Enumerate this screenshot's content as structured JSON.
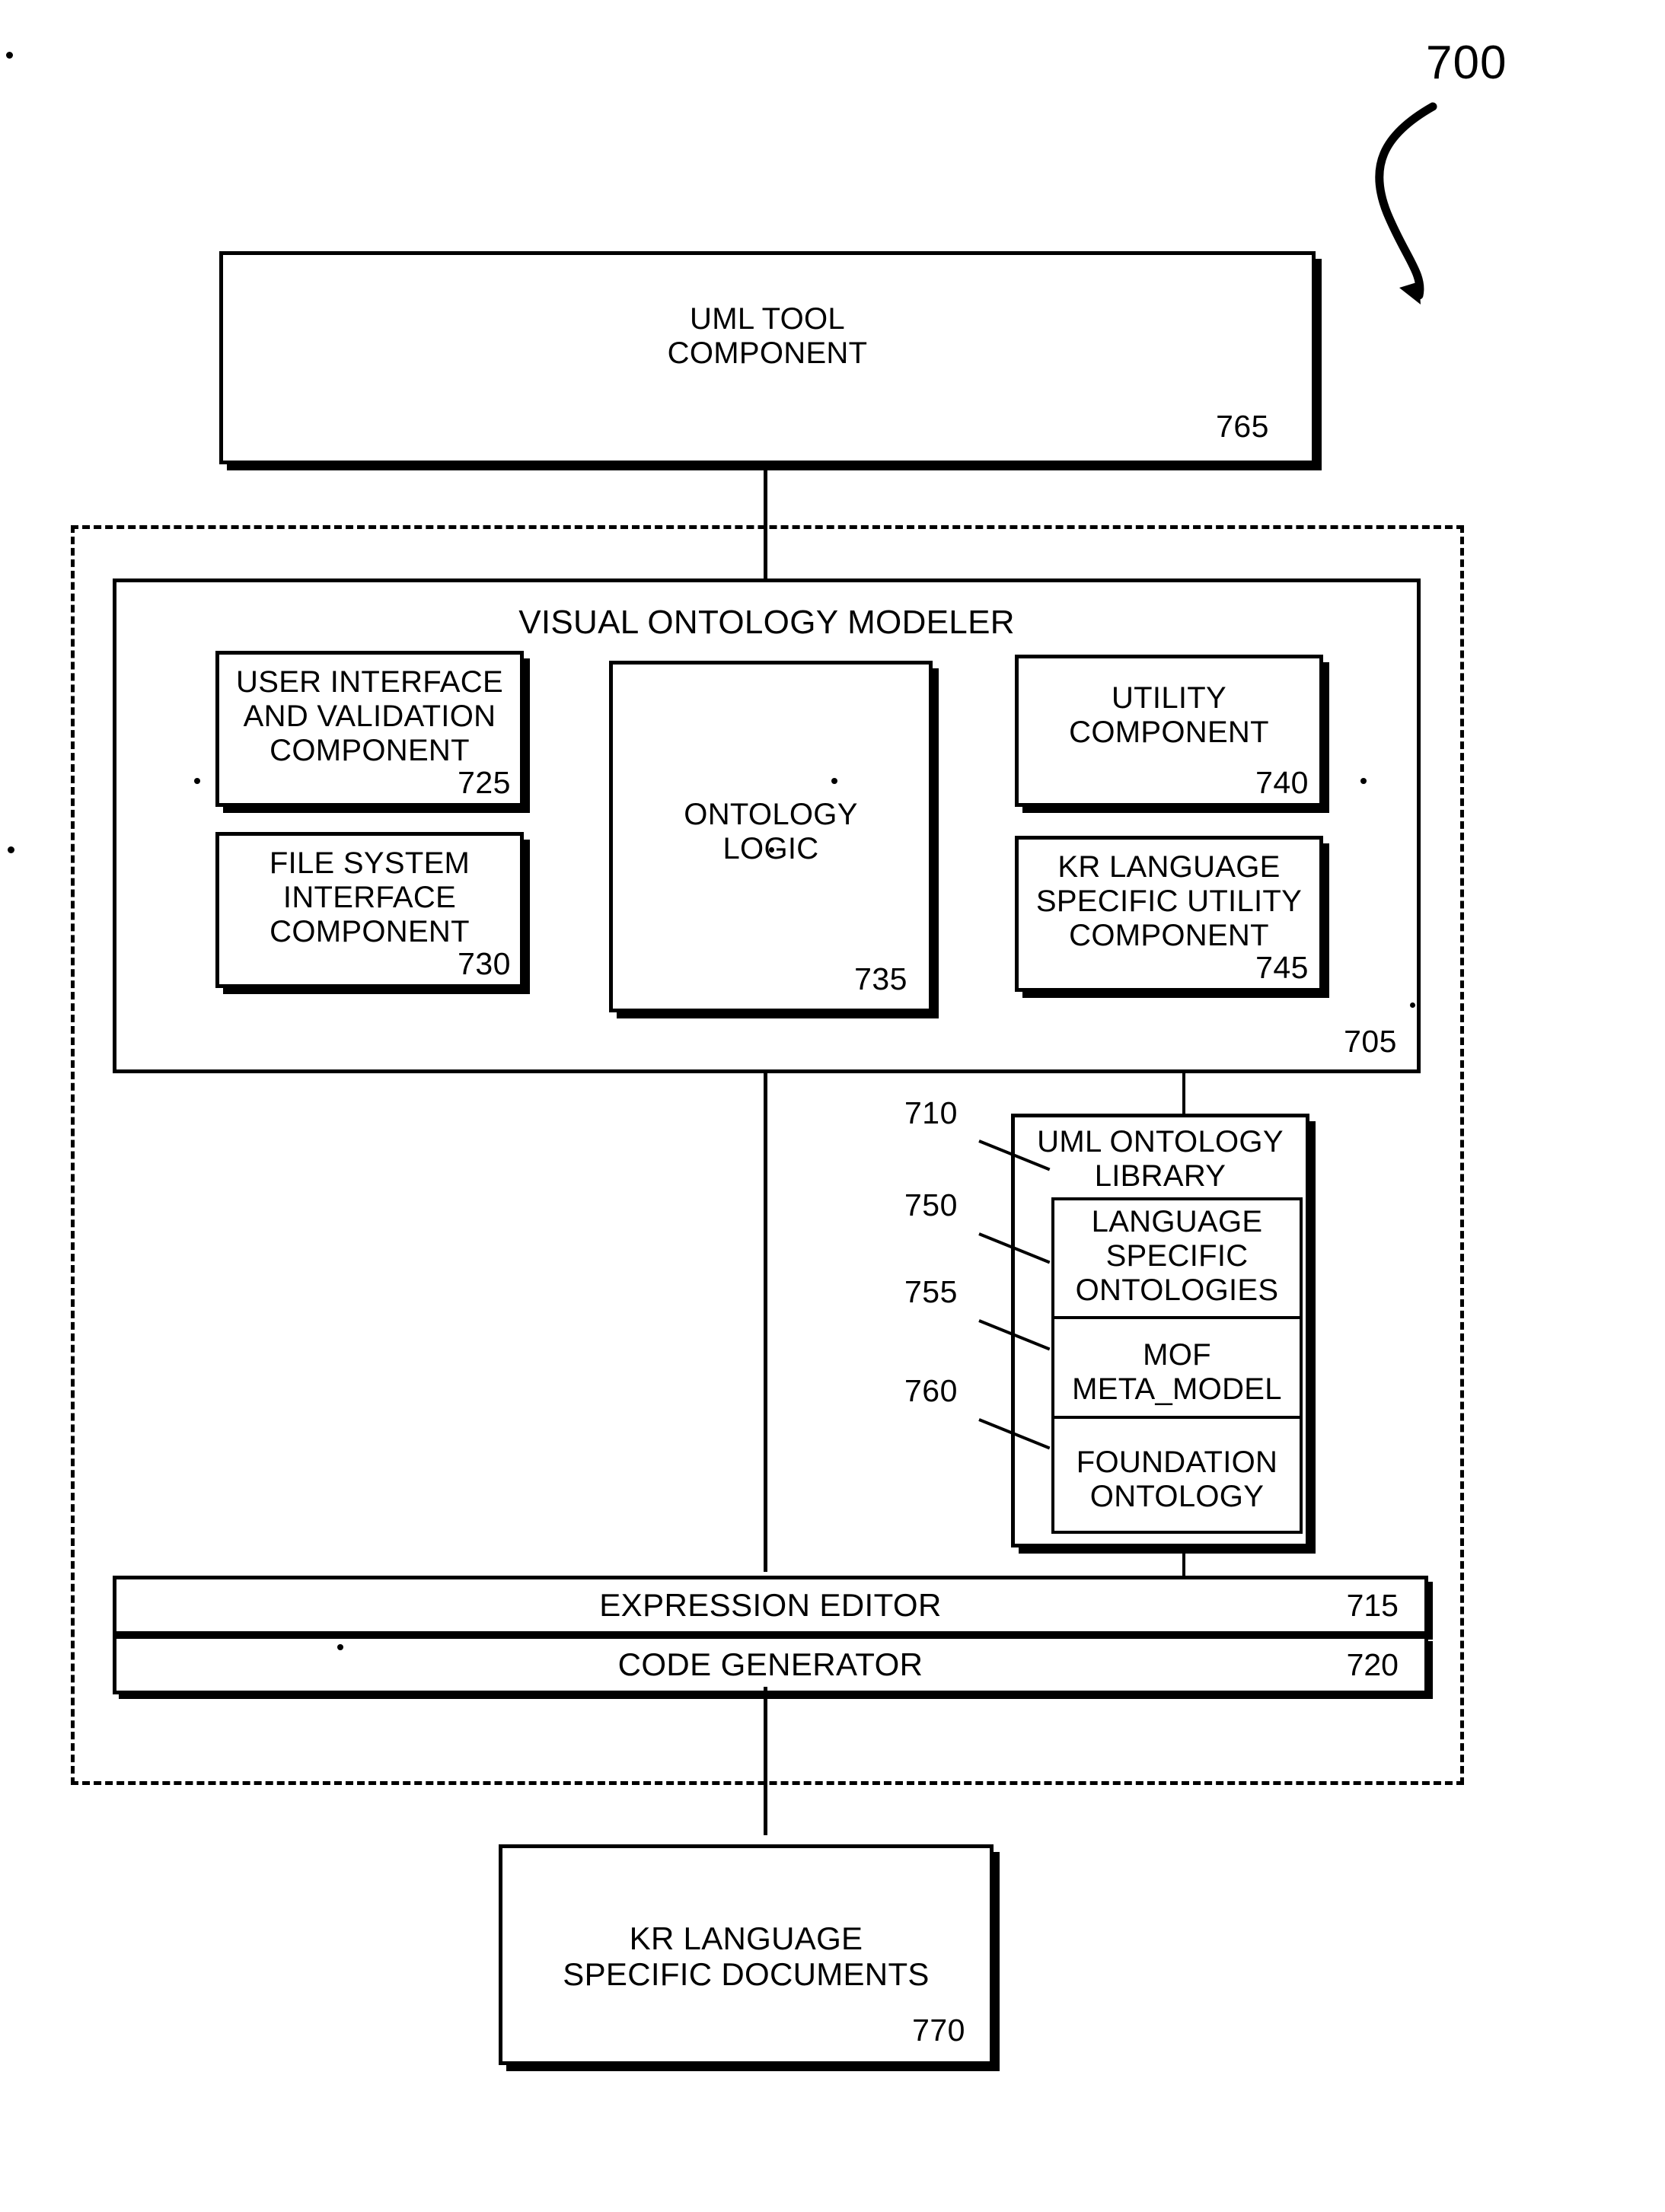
{
  "figure": {
    "number": "700",
    "curved_pointer": "s-curve-arrow-to-dashed-system-boundary"
  },
  "nodes": {
    "uml_tool_component": {
      "label": "UML TOOL\nCOMPONENT",
      "ref": "765"
    },
    "visual_ontology_modeler": {
      "label": "VISUAL ONTOLOGY MODELER",
      "ref": "705"
    },
    "user_interface_and_validation_component": {
      "label": "USER INTERFACE\nAND VALIDATION\nCOMPONENT",
      "ref": "725"
    },
    "file_system_interface_component": {
      "label": "FILE SYSTEM\nINTERFACE\nCOMPONENT",
      "ref": "730"
    },
    "ontology_logic": {
      "label": "ONTOLOGY\nLOGIC",
      "ref": "735"
    },
    "utility_component": {
      "label": "UTILITY\nCOMPONENT",
      "ref": "740"
    },
    "kr_language_specific_utility_component": {
      "label": "KR LANGUAGE\nSPECIFIC UTILITY\nCOMPONENT",
      "ref": "745"
    },
    "uml_ontology_library": {
      "label": "UML ONTOLOGY\nLIBRARY",
      "ref": "710"
    },
    "language_specific_ontologies": {
      "label": "LANGUAGE\nSPECIFIC\nONTOLOGIES",
      "ref": "750"
    },
    "mof_meta_model": {
      "label": "MOF\nMETA_MODEL",
      "ref": "755"
    },
    "foundation_ontology": {
      "label": "FOUNDATION\nONTOLOGY",
      "ref": "760"
    },
    "expression_editor": {
      "label": "EXPRESSION EDITOR",
      "ref": "715"
    },
    "code_generator": {
      "label": "CODE GENERATOR",
      "ref": "720"
    },
    "kr_language_specific_documents": {
      "label": "KR LANGUAGE\nSPECIFIC DOCUMENTS",
      "ref": "770"
    }
  },
  "colors": {
    "ink": "#000000",
    "paper": "#ffffff"
  }
}
